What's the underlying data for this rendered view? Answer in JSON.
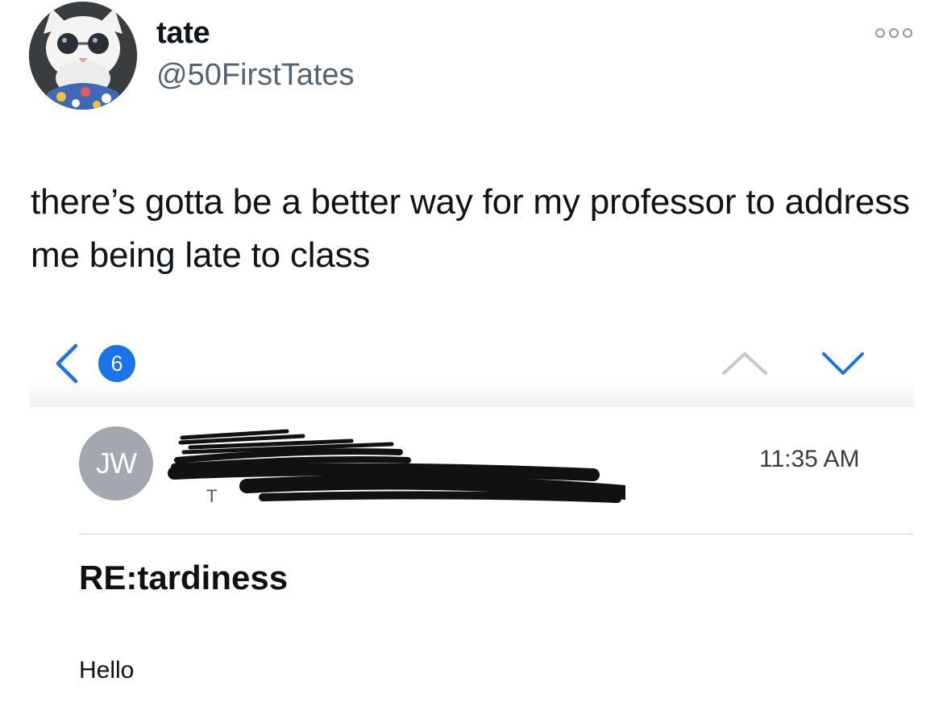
{
  "tweet": {
    "display_name": "tate",
    "handle": "@50FirstTates",
    "more_icon": "more-horizontal-icon",
    "text": "there’s gotta be a better way for my professor to address me being late to class"
  },
  "email": {
    "nav": {
      "back_icon": "chevron-left-icon",
      "unread_count": "6",
      "prev_icon": "chevron-up-icon",
      "next_icon": "chevron-down-icon",
      "accent_color": "#1a73e8"
    },
    "sender_initials": "JW",
    "time": "11:35 AM",
    "subject": "RE:tardiness",
    "body_start": "Hello"
  }
}
